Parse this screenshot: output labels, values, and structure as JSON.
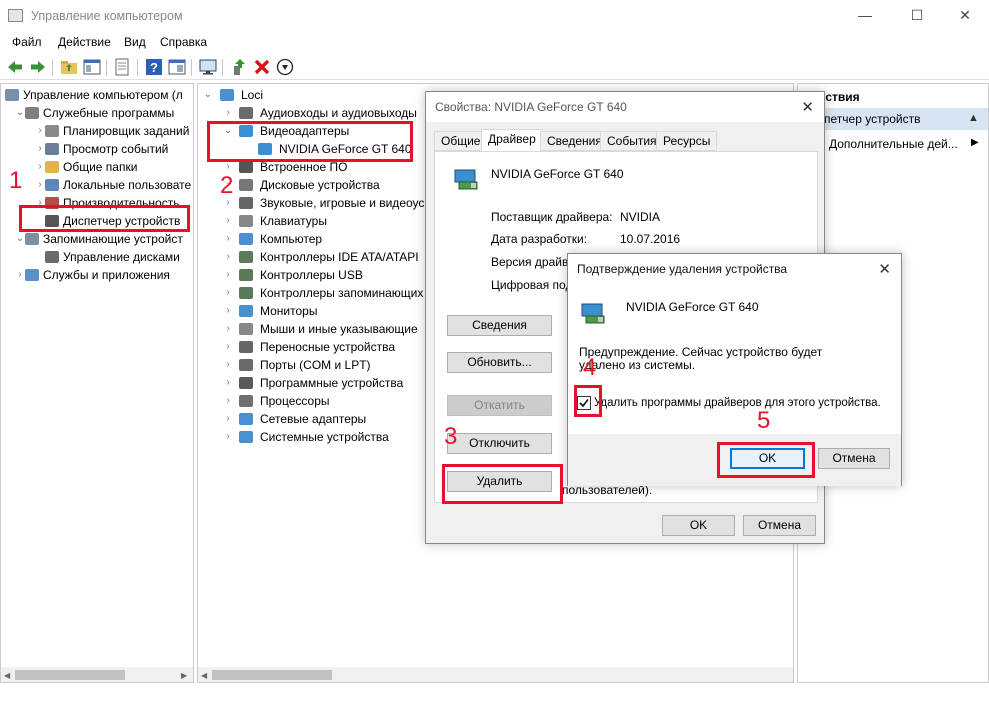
{
  "window": {
    "title": "Управление компьютером",
    "minimize": "—",
    "maximize": "☐",
    "close": "✕"
  },
  "menu": [
    "Файл",
    "Действие",
    "Вид",
    "Справка"
  ],
  "left_tree": [
    {
      "label": "Управление компьютером (л",
      "chev": ""
    },
    {
      "label": "Служебные программы",
      "chev": "⌄"
    },
    {
      "label": "Планировщик заданий",
      "chev": "›"
    },
    {
      "label": "Просмотр событий",
      "chev": "›"
    },
    {
      "label": "Общие папки",
      "chev": "›"
    },
    {
      "label": "Локальные пользовате",
      "chev": "›"
    },
    {
      "label": "Производительность",
      "chev": "›"
    },
    {
      "label": "Диспетчер устройств",
      "chev": ""
    },
    {
      "label": "Запоминающие устройст",
      "chev": "⌄"
    },
    {
      "label": "Управление дисками",
      "chev": ""
    },
    {
      "label": "Службы и приложения",
      "chev": "›"
    }
  ],
  "device_tree": {
    "root": "Loci",
    "items": [
      {
        "label": "Аудиовходы и аудиовыходы",
        "chev": "›",
        "icon": "audio-icon"
      },
      {
        "label": "Видеоадаптеры",
        "chev": "⌄",
        "icon": "display-adapter-icon"
      },
      {
        "label": "NVIDIA GeForce GT 640",
        "chev": "",
        "icon": "gpu-icon"
      },
      {
        "label": "Встроенное ПО",
        "chev": "›",
        "icon": "firmware-icon"
      },
      {
        "label": "Дисковые устройства",
        "chev": "›",
        "icon": "disk-icon"
      },
      {
        "label": "Звуковые, игровые и видеоус",
        "chev": "›",
        "icon": "sound-icon"
      },
      {
        "label": "Клавиатуры",
        "chev": "›",
        "icon": "keyboard-icon"
      },
      {
        "label": "Компьютер",
        "chev": "›",
        "icon": "computer-icon"
      },
      {
        "label": "Контроллеры IDE ATA/ATAPI",
        "chev": "›",
        "icon": "ide-icon"
      },
      {
        "label": "Контроллеры USB",
        "chev": "›",
        "icon": "usb-icon"
      },
      {
        "label": "Контроллеры запоминающих",
        "chev": "›",
        "icon": "storage-controller-icon"
      },
      {
        "label": "Мониторы",
        "chev": "›",
        "icon": "monitor-icon"
      },
      {
        "label": "Мыши и иные указывающие",
        "chev": "›",
        "icon": "mouse-icon"
      },
      {
        "label": "Переносные устройства",
        "chev": "›",
        "icon": "portable-icon"
      },
      {
        "label": "Порты (COM и LPT)",
        "chev": "›",
        "icon": "port-icon"
      },
      {
        "label": "Программные устройства",
        "chev": "›",
        "icon": "software-device-icon"
      },
      {
        "label": "Процессоры",
        "chev": "›",
        "icon": "cpu-icon"
      },
      {
        "label": "Сетевые адаптеры",
        "chev": "›",
        "icon": "network-icon"
      },
      {
        "label": "Системные устройства",
        "chev": "›",
        "icon": "system-icon"
      }
    ]
  },
  "actions": {
    "header": "йствия",
    "selected": "спетчер устройств",
    "more": "Дополнительные дей...",
    "more_arrow": "▶",
    "collapse_arrow": "▲"
  },
  "props_dialog": {
    "title": "Свойства: NVIDIA GeForce GT 640",
    "close": "✕",
    "tabs": [
      "Общие",
      "Драйвер",
      "Сведения",
      "События",
      "Ресурсы"
    ],
    "device_name": "NVIDIA GeForce GT 640",
    "rows": [
      {
        "label": "Поставщик драйвера:",
        "value": "NVIDIA"
      },
      {
        "label": "Дата разработки:",
        "value": "10.07.2016"
      },
      {
        "label": "Версия драйве",
        "value": ""
      },
      {
        "label": "Цифровая под",
        "value": ""
      }
    ],
    "buttons": {
      "details": "Сведения",
      "update": "Обновить...",
      "rollback": "Откатить",
      "disable": "Отключить",
      "delete": "Удалить"
    },
    "side_text": "пользователей).",
    "ok": "OK",
    "cancel": "Отмена"
  },
  "confirm_dialog": {
    "title": "Подтверждение удаления устройства",
    "close": "✕",
    "device_name": "NVIDIA GeForce GT 640",
    "warning": "Предупреждение. Сейчас устройство будет удалено из системы.",
    "checkbox_label": "Удалить программы драйверов для этого устройства.",
    "checkbox_checked": true,
    "ok": "OK",
    "cancel": "Отмена"
  },
  "annotations": [
    "1",
    "2",
    "3",
    "4",
    "5"
  ],
  "colors": {
    "highlight": "#e8112d",
    "accent": "#0078d7",
    "actions_header": "#d7e4f2"
  }
}
